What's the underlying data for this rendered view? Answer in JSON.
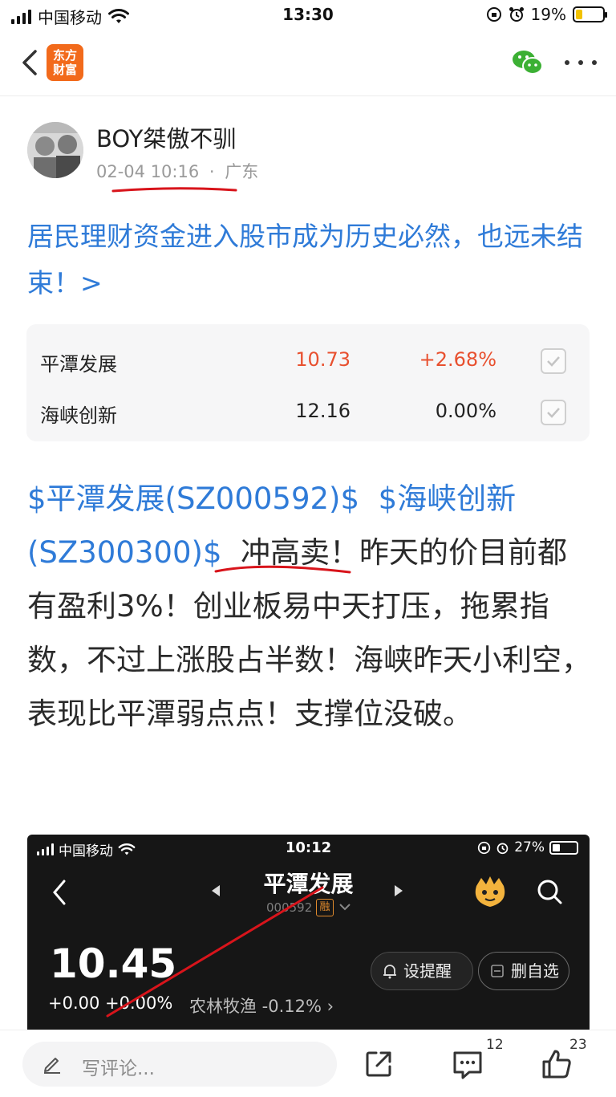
{
  "status_bar": {
    "carrier": "中国移动",
    "time": "13:30",
    "battery": "19%"
  },
  "nav": {
    "app_logo_line1": "东方",
    "app_logo_line2": "财富"
  },
  "author": {
    "name": "BOY桀傲不驯",
    "date": "02-04 10:16",
    "separator": "·",
    "location": "广东"
  },
  "post": {
    "title": "居民理财资金进入股市成为历史必然，也远未结束！>",
    "tag1": "$平潭发展(SZ000592)$",
    "tag2": "$海峡创新(SZ300300)$",
    "highlight": "冲高卖！",
    "body_rest": "昨天的价目前都有盈利3%！创业板易中天打压，拖累指数，不过上涨股占半数！海峡昨天小利空，表现比平潭弱点点！支撑位没破。"
  },
  "stocks": [
    {
      "name": "平潭发展",
      "price": "10.73",
      "change": "+2.68%",
      "color": "#e8502f"
    },
    {
      "name": "海峡创新",
      "price": "12.16",
      "change": "0.00%",
      "color": "#222222"
    }
  ],
  "embedded_screenshot": {
    "carrier": "中国移动",
    "time": "10:12",
    "battery": "27%",
    "title": "平潭发展",
    "code": "000592",
    "rong_badge": "融",
    "price": "10.45",
    "change": "+0.00  +0.00%",
    "sector": "农林牧渔 -0.12% ›",
    "alert_button": "设提醒",
    "remove_button": "删自选"
  },
  "bottom_bar": {
    "comment_placeholder": "写评论...",
    "comment_count": "12",
    "like_count": "23"
  },
  "colors": {
    "link_blue": "#2f7bd8",
    "up_red": "#e8502f",
    "annotation_red": "#d8141b",
    "brand_orange": "#f26a1b"
  }
}
